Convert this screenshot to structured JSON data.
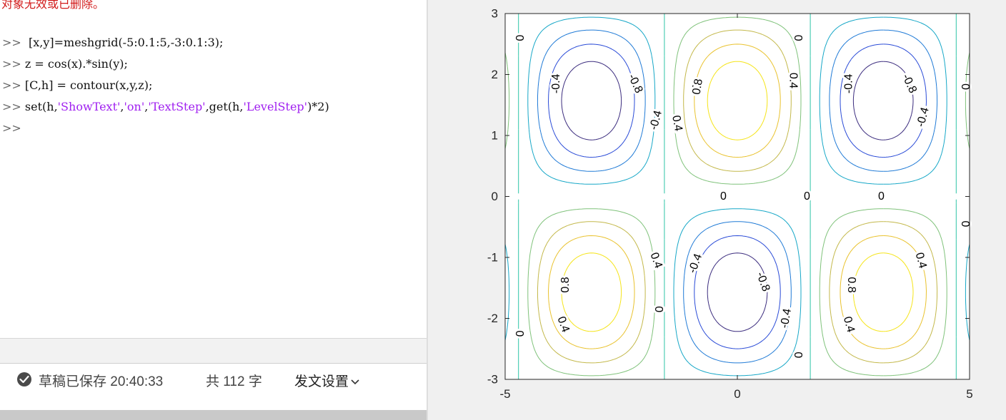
{
  "editor": {
    "top_message": "对象无效或已删除。",
    "prompt": ">>",
    "lines": [
      {
        "plain": " [x,y]=meshgrid(-5:0.1:5,-3:0.1:3);"
      },
      {
        "plain": "z = cos(x).*sin(y);"
      },
      {
        "plain": "[C,h] = contour(x,y,z);"
      }
    ],
    "set_line": {
      "p1": "set(h,",
      "s1": "'ShowText'",
      "c1": ",",
      "s2": "'on'",
      "c2": ",",
      "s3": "'TextStep'",
      "p2": ",get(h,",
      "s4": "'LevelStep'",
      "p3": ")*2)"
    }
  },
  "status_bar": {
    "saved": "草稿已保存 20:40:33",
    "word_count": "共 112 字",
    "publish_settings": "发文设置",
    "icons": [
      "check-circle-icon",
      "chevron-down-icon"
    ]
  },
  "chart_data": {
    "type": "contour",
    "function": "z = cos(x).*sin(y)",
    "xlim": [
      -5,
      5
    ],
    "ylim": [
      -3,
      3
    ],
    "x_ticks": [
      "-5",
      "0",
      "5"
    ],
    "y_ticks": [
      "3",
      "2",
      "1",
      "0",
      "-1",
      "-2",
      "-3"
    ],
    "levels": [
      -0.8,
      -0.6,
      -0.4,
      -0.2,
      0,
      0.2,
      0.4,
      0.6,
      0.8
    ],
    "level_colors": {
      "-0.8": "#3b2c7e",
      "-0.6": "#2a4bd7",
      "-0.4": "#1f7ad6",
      "-0.2": "#16a7c7",
      "0": "#2ec4a6",
      "0.2": "#7fc27a",
      "0.4": "#c3b84a",
      "0.6": "#e9c22e",
      "0.8": "#f5e418"
    },
    "labels": [
      {
        "text": "0",
        "x": -4.7,
        "y": 2.6,
        "angle": 90
      },
      {
        "text": "-0.4",
        "x": -3.9,
        "y": 1.85,
        "angle": -90
      },
      {
        "text": "-0.8",
        "x": -2.2,
        "y": 1.85,
        "angle": 65
      },
      {
        "text": "-0.4",
        "x": -1.75,
        "y": 1.25,
        "angle": -75
      },
      {
        "text": "0",
        "x": -0.3,
        "y": 0.0,
        "angle": 0
      },
      {
        "text": "0",
        "x": -0.9,
        "y": 1.8,
        "angle": 90
      },
      {
        "text": "0.4",
        "x": -1.3,
        "y": 1.2,
        "angle": 80
      },
      {
        "text": "0.8",
        "x": -0.85,
        "y": 1.8,
        "angle": -80
      },
      {
        "text": "0.4",
        "x": 1.2,
        "y": 1.9,
        "angle": 90
      },
      {
        "text": "0",
        "x": 1.3,
        "y": 2.6,
        "angle": 90
      },
      {
        "text": "0",
        "x": 1.5,
        "y": 0.0,
        "angle": 0
      },
      {
        "text": "0",
        "x": 3.1,
        "y": 0.0,
        "angle": 0
      },
      {
        "text": "-0.4",
        "x": 2.4,
        "y": 1.85,
        "angle": -90
      },
      {
        "text": "-0.8",
        "x": 3.7,
        "y": 1.85,
        "angle": 65
      },
      {
        "text": "-0.4",
        "x": 4.0,
        "y": 1.3,
        "angle": -75
      },
      {
        "text": "0",
        "x": 4.9,
        "y": 1.8,
        "angle": 90
      },
      {
        "text": "0",
        "x": 4.9,
        "y": -0.45,
        "angle": 90
      },
      {
        "text": "0.4",
        "x": -1.75,
        "y": -1.05,
        "angle": 70
      },
      {
        "text": "0.8",
        "x": -3.7,
        "y": -1.45,
        "angle": -90
      },
      {
        "text": "0.4",
        "x": -3.75,
        "y": -2.1,
        "angle": 70
      },
      {
        "text": "0",
        "x": -4.7,
        "y": -2.25,
        "angle": 90
      },
      {
        "text": "-0.4",
        "x": -0.9,
        "y": -1.1,
        "angle": -70
      },
      {
        "text": "0",
        "x": -1.7,
        "y": -1.85,
        "angle": 90
      },
      {
        "text": "-0.8",
        "x": 0.55,
        "y": -1.4,
        "angle": 70
      },
      {
        "text": "-0.4",
        "x": 1.05,
        "y": -2.0,
        "angle": -80
      },
      {
        "text": "0",
        "x": 1.3,
        "y": -2.6,
        "angle": 90
      },
      {
        "text": "0.8",
        "x": 2.45,
        "y": -1.45,
        "angle": 90
      },
      {
        "text": "0.4",
        "x": 3.95,
        "y": -1.05,
        "angle": 75
      },
      {
        "text": "0.4",
        "x": 2.4,
        "y": -2.1,
        "angle": 75
      }
    ]
  }
}
